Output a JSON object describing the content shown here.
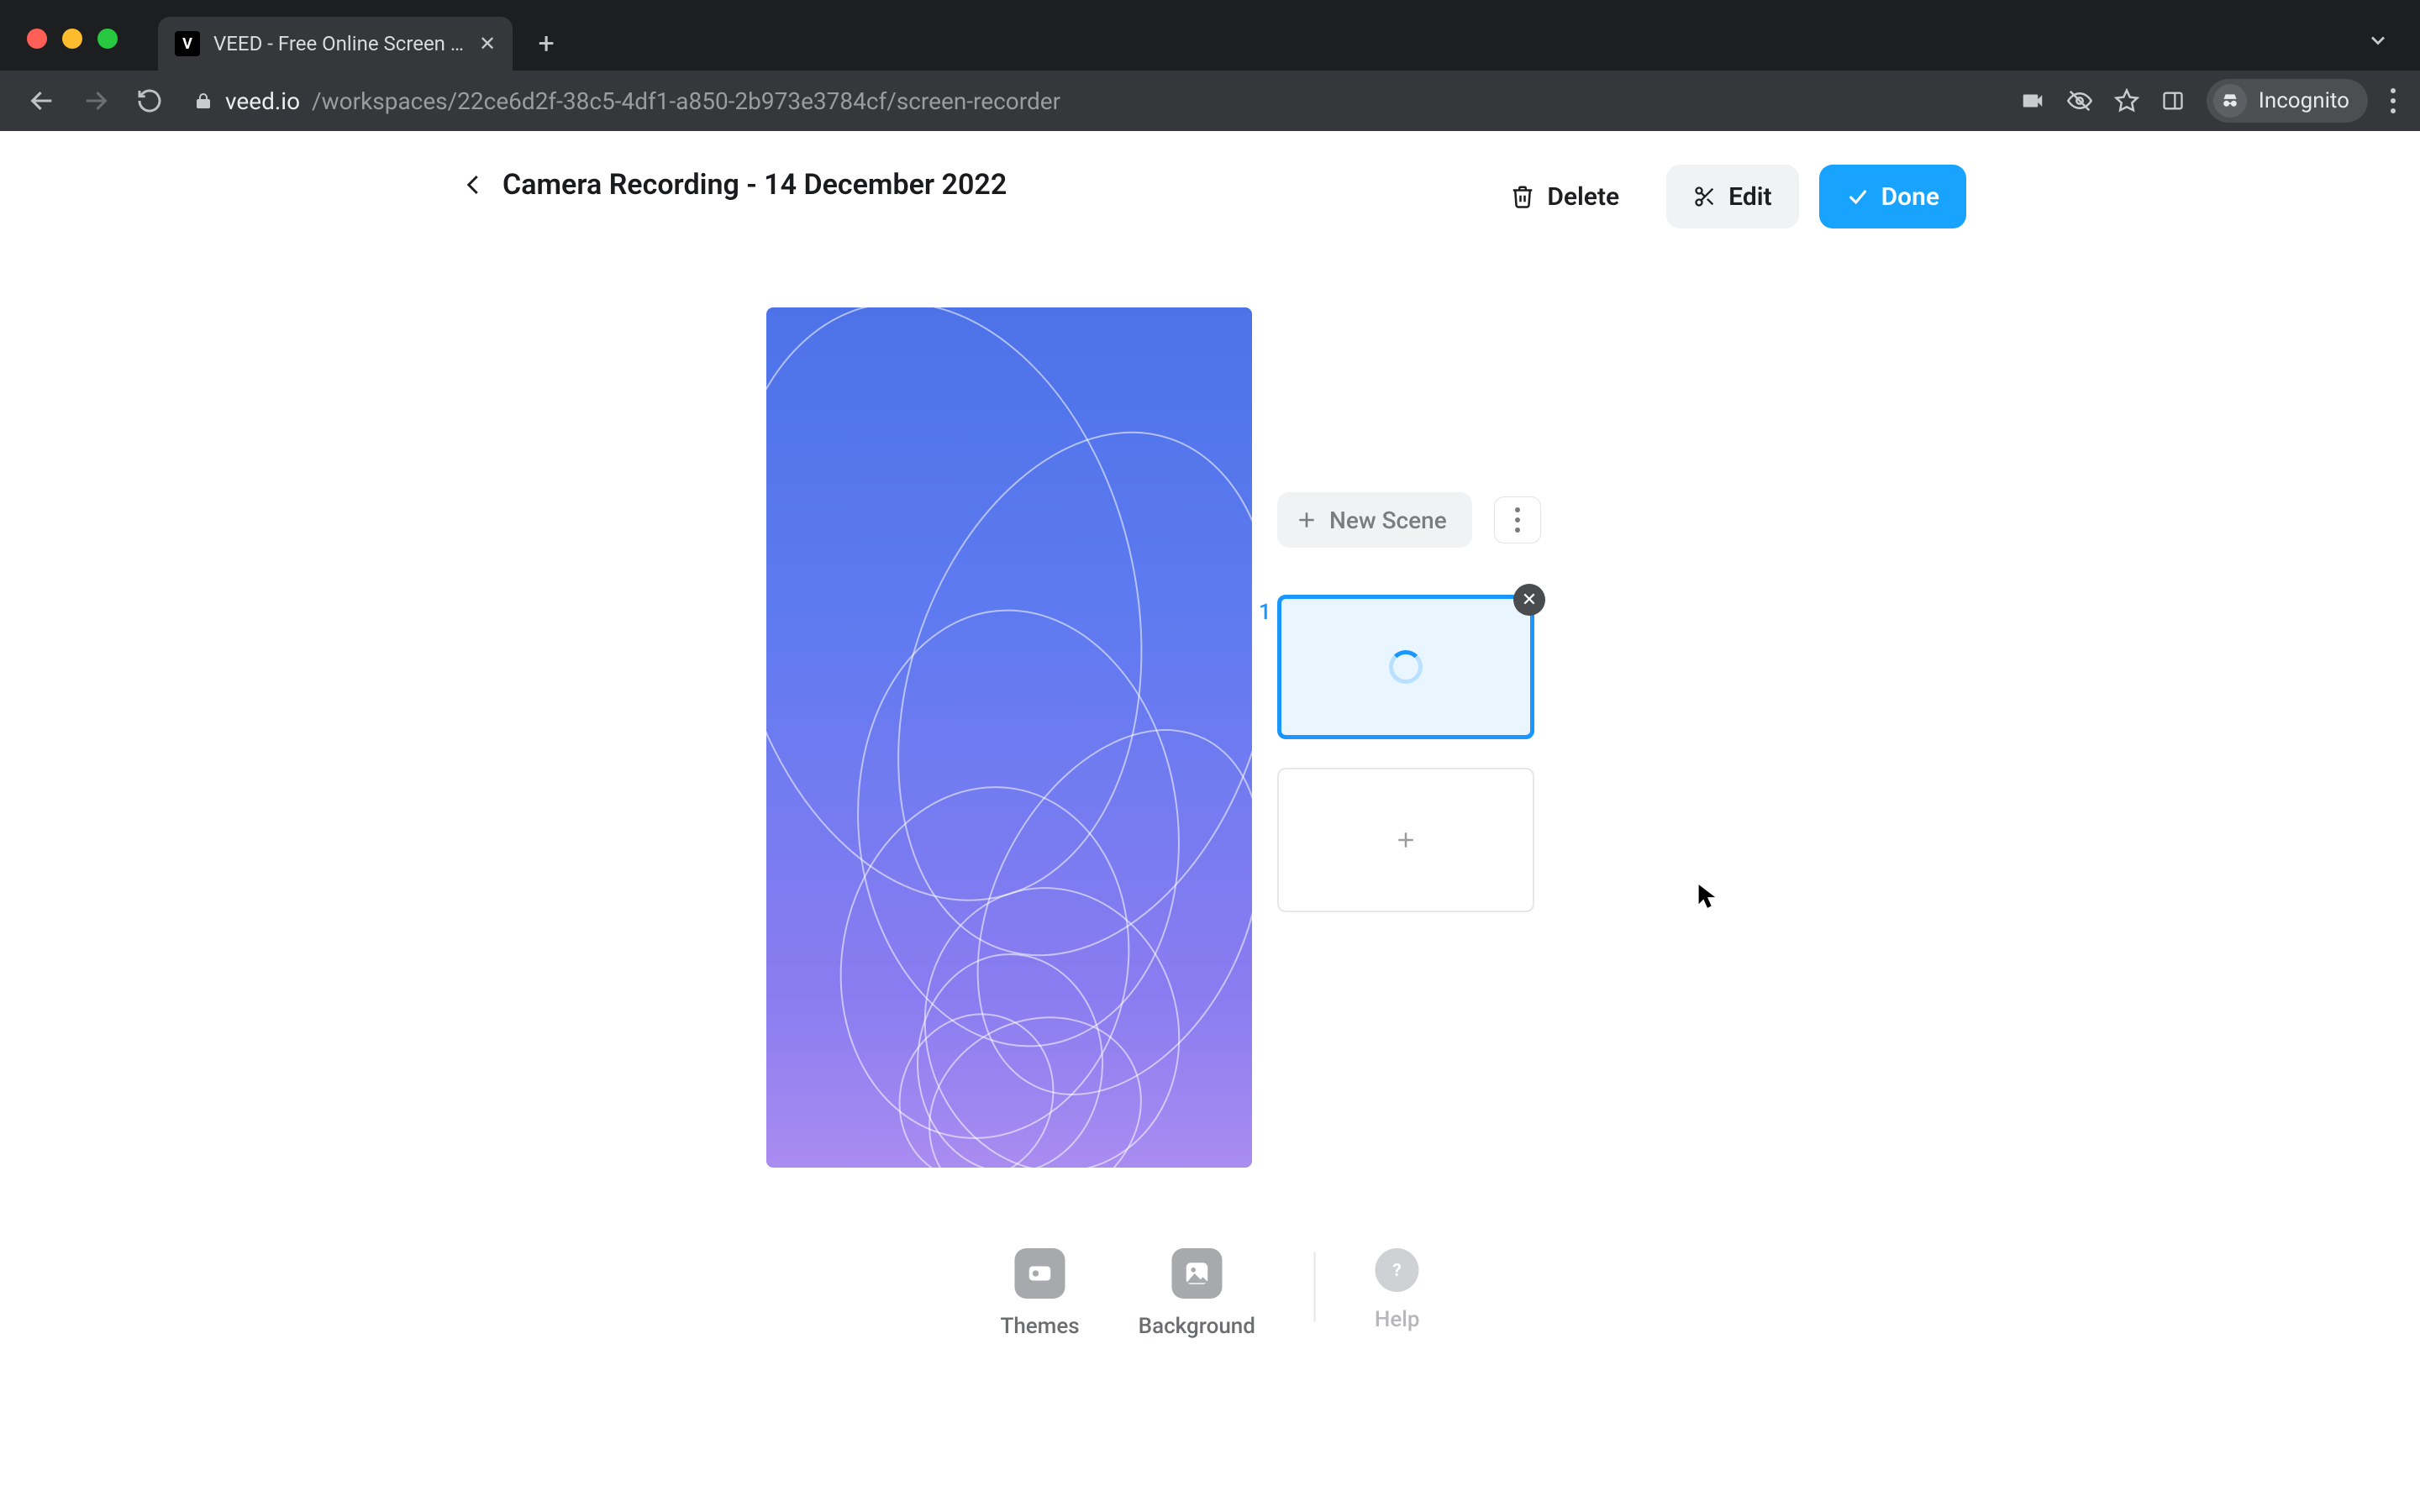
{
  "browser": {
    "tab_title": "VEED - Free Online Screen & V",
    "favicon_letter": "V",
    "url_host": "veed.io",
    "url_path": "/workspaces/22ce6d2f-38c5-4df1-a850-2b973e3784cf/screen-recorder",
    "incognito_label": "Incognito"
  },
  "header": {
    "title": "Camera Recording - 14 December 2022",
    "delete_label": "Delete",
    "edit_label": "Edit",
    "done_label": "Done"
  },
  "scenes": {
    "new_scene_label": "New Scene",
    "items": [
      {
        "index": "1",
        "status": "loading"
      }
    ]
  },
  "bottom": {
    "themes_label": "Themes",
    "background_label": "Background",
    "help_label": "Help"
  },
  "colors": {
    "primary": "#17a3ff",
    "accent": "#1997ff"
  }
}
